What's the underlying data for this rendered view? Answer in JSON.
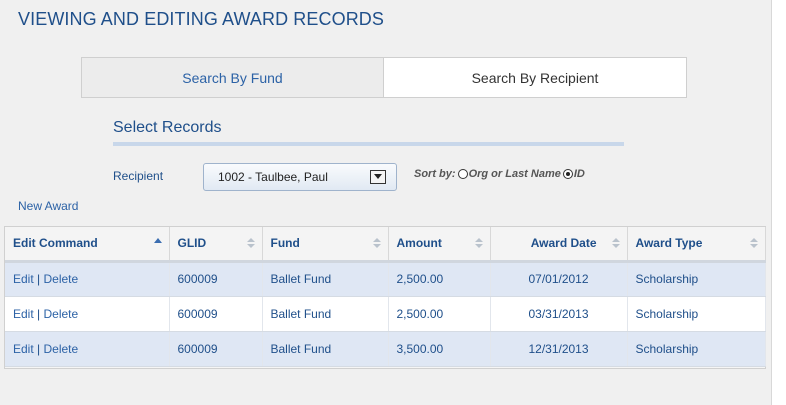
{
  "page": {
    "title": "VIEWING AND EDITING AWARD RECORDS"
  },
  "tabs": [
    {
      "label": "Search By Fund",
      "active": false
    },
    {
      "label": "Search By Recipient",
      "active": true
    }
  ],
  "select_records": {
    "title": "Select Records",
    "recipient_label": "Recipient",
    "recipient_value": "1002 - Taulbee, Paul",
    "sort_label": "Sort by:",
    "sort_options": [
      "Org or Last Name",
      "ID"
    ],
    "sort_selected": "ID"
  },
  "new_award_label": "New Award",
  "grid": {
    "columns": [
      "Edit Command",
      "GLID",
      "Fund",
      "Amount",
      "Award Date",
      "Award Type"
    ],
    "edit_label": "Edit",
    "separator": "|",
    "delete_label": "Delete",
    "rows": [
      {
        "glid": "600009",
        "fund": "Ballet Fund",
        "amount": "2,500.00",
        "award_date": "07/01/2012",
        "award_type": "Scholarship"
      },
      {
        "glid": "600009",
        "fund": "Ballet Fund",
        "amount": "2,500.00",
        "award_date": "03/31/2013",
        "award_type": "Scholarship"
      },
      {
        "glid": "600009",
        "fund": "Ballet Fund",
        "amount": "3,500.00",
        "award_date": "12/31/2013",
        "award_type": "Scholarship"
      }
    ]
  },
  "colors": {
    "title_blue": "#1f4f8a",
    "link_blue": "#2c62a6",
    "row_highlight": "#dfe7f4",
    "panel_bg": "#f0f0f0"
  }
}
